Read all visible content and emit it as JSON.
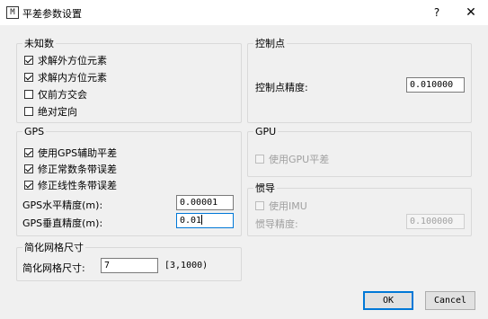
{
  "window": {
    "icon": "M",
    "title": "平差参数设置",
    "help": "?",
    "close": "✕"
  },
  "unknowns": {
    "legend": "未知数",
    "items": [
      {
        "label": "求解外方位元素",
        "checked": true
      },
      {
        "label": "求解内方位元素",
        "checked": true
      },
      {
        "label": "仅前方交会",
        "checked": false
      },
      {
        "label": "绝对定向",
        "checked": false
      }
    ]
  },
  "control": {
    "legend": "控制点",
    "precision_label": "控制点精度:",
    "precision_value": "0.010000"
  },
  "gps": {
    "legend": "GPS",
    "items": [
      {
        "label": "使用GPS辅助平差",
        "checked": true
      },
      {
        "label": "修正常数条带误差",
        "checked": true
      },
      {
        "label": "修正线性条带误差",
        "checked": true
      }
    ],
    "h_label": "GPS水平精度(m):",
    "h_value": "0.00001",
    "v_label": "GPS垂直精度(m):",
    "v_value": "0.01"
  },
  "gpu": {
    "legend": "GPU",
    "use_label": "使用GPU平差",
    "checked": false
  },
  "imu": {
    "legend": "惯导",
    "use_label": "使用IMU",
    "checked": false,
    "precision_label": "惯导精度:",
    "precision_value": "0.100000"
  },
  "grid": {
    "legend": "简化网格尺寸",
    "label": "简化网格尺寸:",
    "value": "7",
    "range": "[3,1000)"
  },
  "buttons": {
    "ok": "OK",
    "cancel": "Cancel"
  }
}
